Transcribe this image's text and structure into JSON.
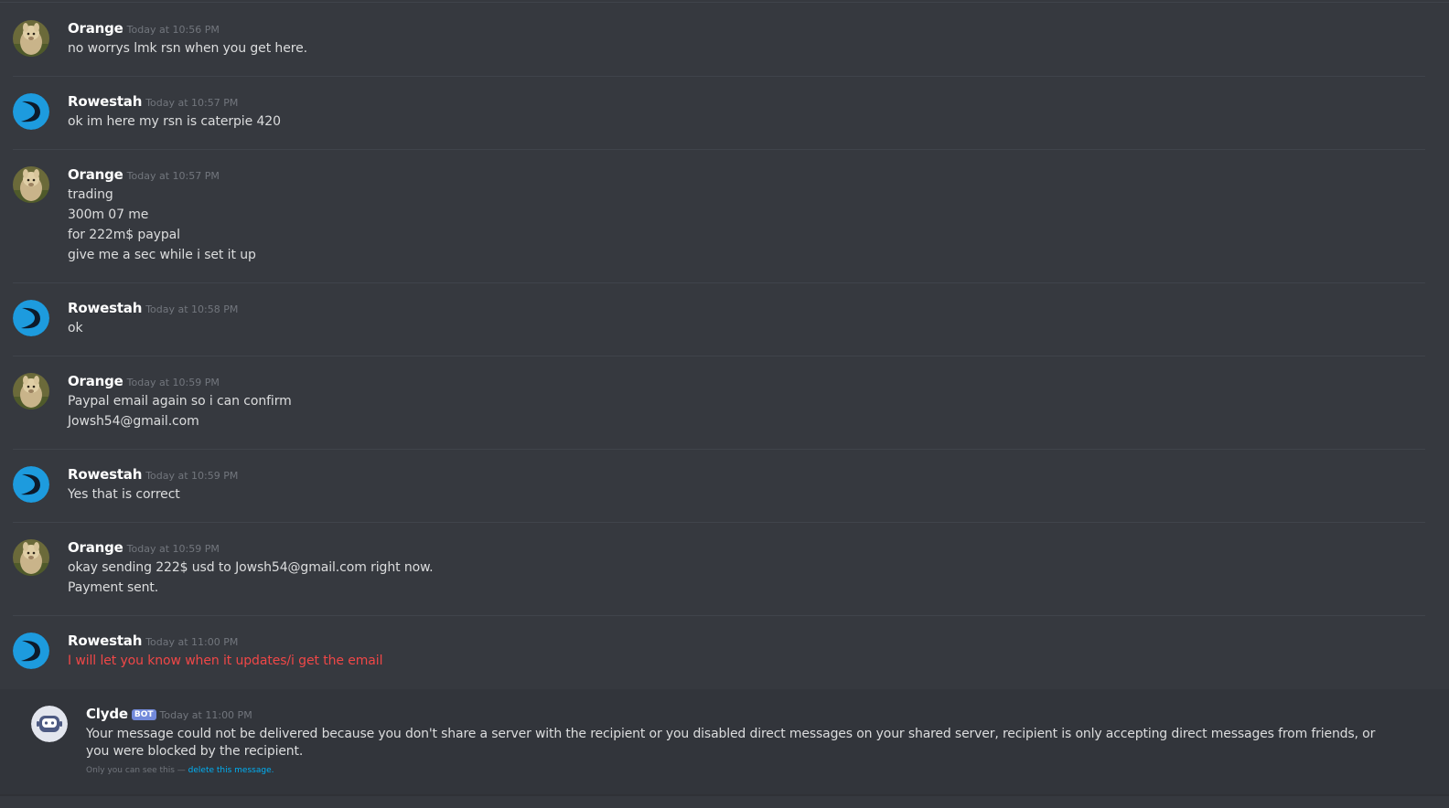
{
  "messages": [
    {
      "author": "Orange",
      "timestamp": "Today at 10:56 PM",
      "avatar": "alpaca-avatar",
      "lines": [
        "no worrys lmk rsn when you get here."
      ]
    },
    {
      "author": "Rowestah",
      "timestamp": "Today at 10:57 PM",
      "avatar": "blue-swoosh-avatar",
      "lines": [
        "ok im here my rsn is caterpie 420"
      ]
    },
    {
      "author": "Orange",
      "timestamp": "Today at 10:57 PM",
      "avatar": "alpaca-avatar",
      "lines": [
        "trading",
        "300m 07 me",
        "for 222m$ paypal",
        "give me a sec while i set it up"
      ]
    },
    {
      "author": "Rowestah",
      "timestamp": "Today at 10:58 PM",
      "avatar": "blue-swoosh-avatar",
      "lines": [
        "ok"
      ]
    },
    {
      "author": "Orange",
      "timestamp": "Today at 10:59 PM",
      "avatar": "alpaca-avatar",
      "lines": [
        "Paypal email again so i can confirm",
        "Jowsh54@gmail.com"
      ]
    },
    {
      "author": "Rowestah",
      "timestamp": "Today at 10:59 PM",
      "avatar": "blue-swoosh-avatar",
      "lines": [
        "Yes that is correct"
      ]
    },
    {
      "author": "Orange",
      "timestamp": "Today at 10:59 PM",
      "avatar": "alpaca-avatar",
      "lines": [
        "okay sending 222$ usd to Jowsh54@gmail.com right now.",
        "Payment sent."
      ]
    },
    {
      "author": "Rowestah",
      "timestamp": "Today at 11:00 PM",
      "avatar": "blue-swoosh-avatar",
      "lines": [
        "I will let you know when it updates/i get the email"
      ],
      "failed": true
    }
  ],
  "bot_message": {
    "author": "Clyde",
    "tag": "BOT",
    "timestamp": "Today at 11:00 PM",
    "avatar": "clyde-bot-avatar",
    "text": "Your message could not be delivered because you don't share a server with the recipient or you disabled direct messages on your shared server, recipient is only accepting direct messages from friends, or you were blocked by the recipient.",
    "note_prefix": "Only you can see this — ",
    "note_link": "delete this message."
  },
  "colors": {
    "background": "#36393f",
    "username": "#ffffff",
    "message_text": "#dcddde",
    "timestamp": "#72767d",
    "failed_text": "#f04747",
    "link": "#00b0f4",
    "bot_tag": "#7289da"
  }
}
